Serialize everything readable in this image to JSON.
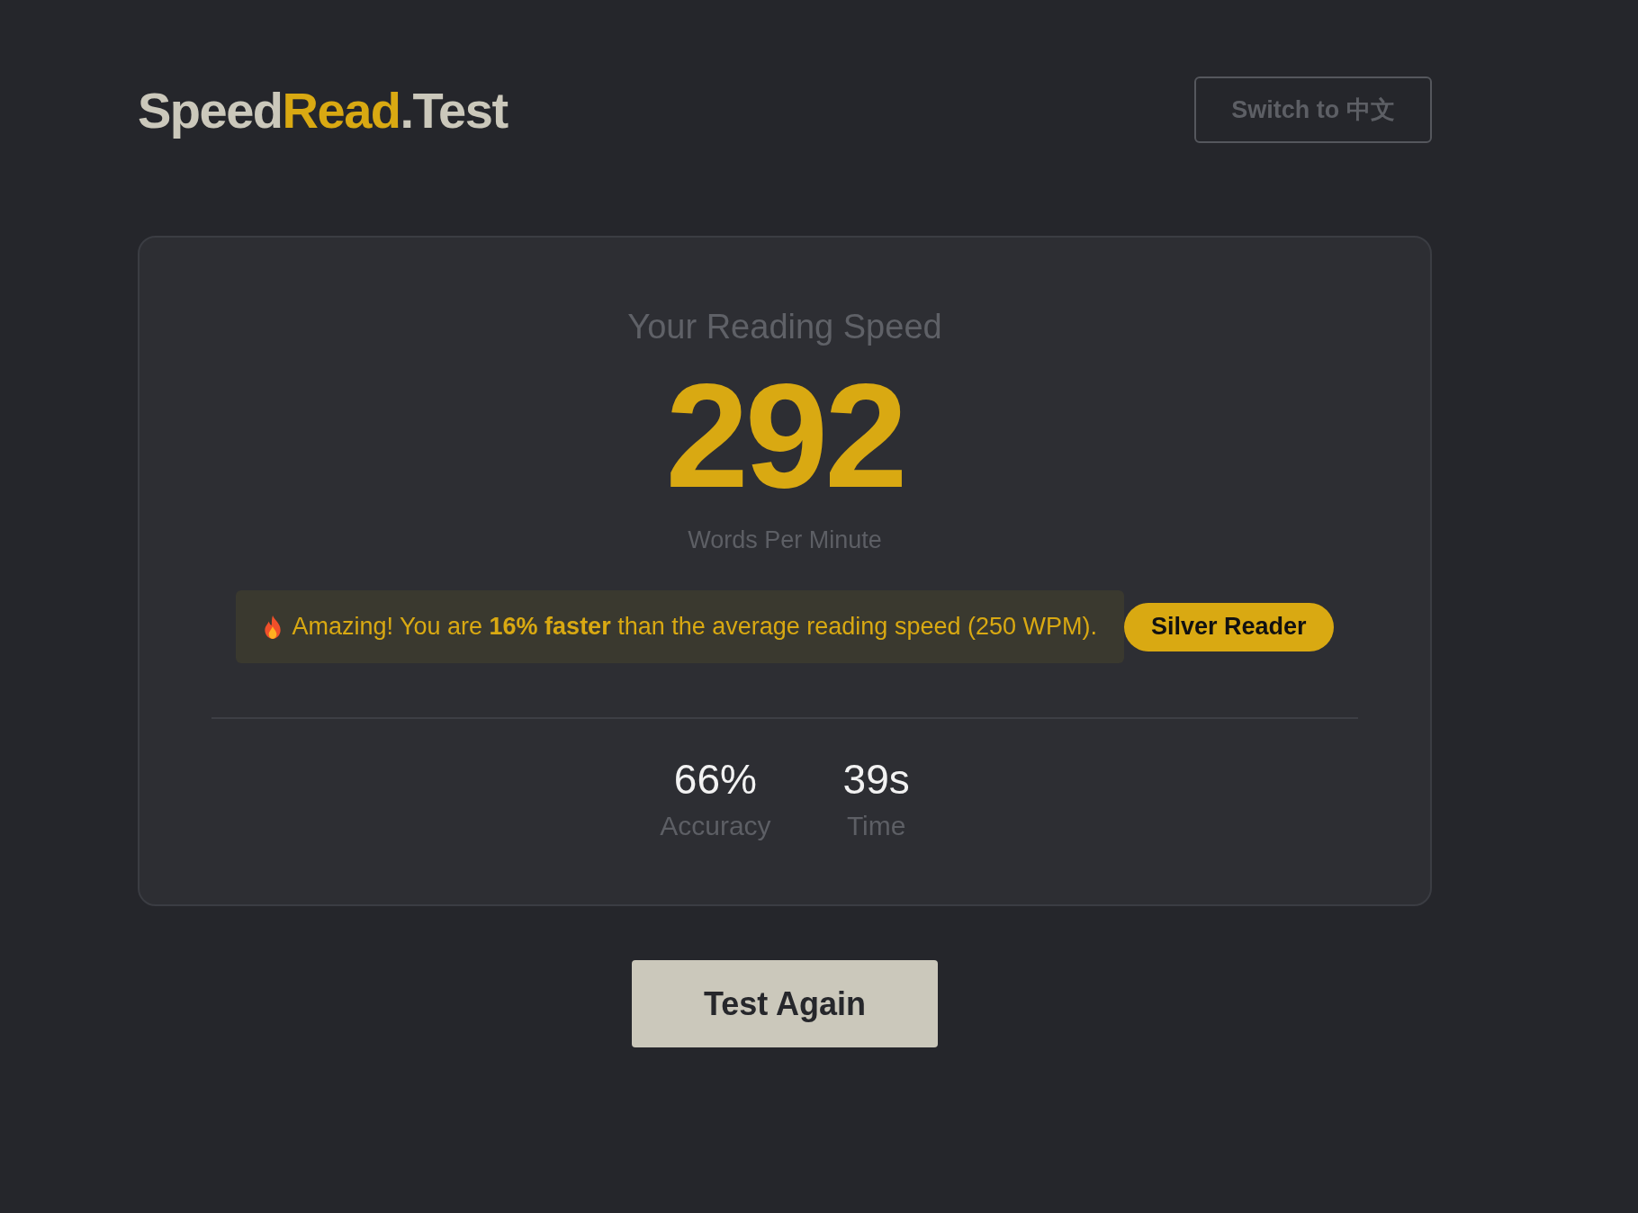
{
  "logo": [
    {
      "text": "Speed",
      "color": "#cbc8bb"
    },
    {
      "text": "Read",
      "color": "#d9a912"
    },
    {
      "text": ".Test",
      "color": "#cbc8bb"
    }
  ],
  "language_button": "Switch to 中文",
  "result": {
    "heading": "Your Reading Speed",
    "wpm": "292",
    "unit": "Words Per Minute",
    "message": "Amazing! You are **16% faster** than the average reading speed (250 WPM).",
    "badge": "Silver Reader",
    "stats": [
      {
        "value": "66%",
        "label": "Accuracy"
      },
      {
        "value": "39s",
        "label": "Time"
      }
    ]
  },
  "retry_button": "Test Again"
}
